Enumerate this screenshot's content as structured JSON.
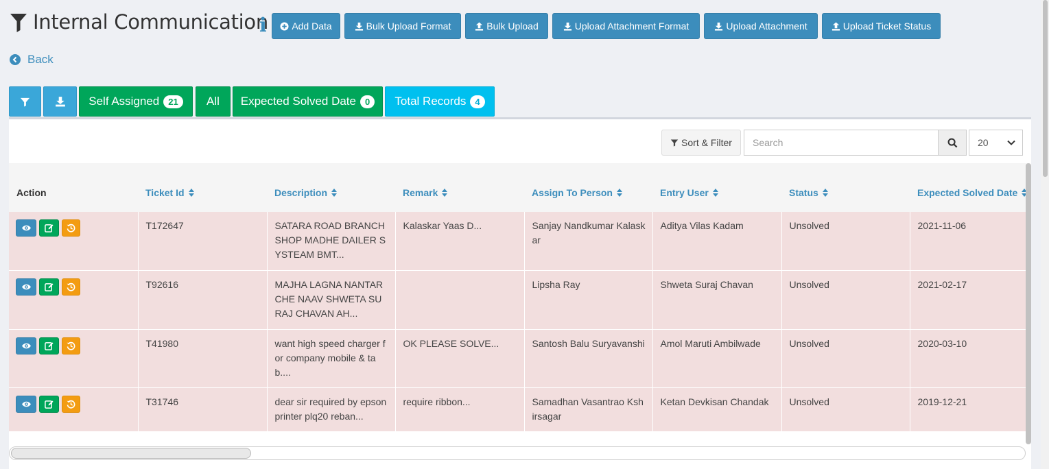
{
  "header": {
    "title": "Internal Communication",
    "info_glyph": "i",
    "buttons": [
      {
        "label": "Add Data",
        "icon": "plus-circle-icon"
      },
      {
        "label": "Bulk Upload Format",
        "icon": "download-icon"
      },
      {
        "label": "Bulk Upload",
        "icon": "upload-icon"
      },
      {
        "label": "Upload Attachment Format",
        "icon": "download-icon"
      },
      {
        "label": "Upload Attachment",
        "icon": "download-icon"
      },
      {
        "label": "Upload Ticket Status",
        "icon": "upload-icon"
      }
    ]
  },
  "back_label": "Back",
  "tabs": [
    {
      "label": "Self Assigned",
      "count": "21"
    },
    {
      "label": "All"
    },
    {
      "label": "Expected Solved Date",
      "count": "0"
    },
    {
      "label": "Total Records",
      "count": "4"
    }
  ],
  "toolbar": {
    "sort_filter_label": "Sort & Filter",
    "search_placeholder": "Search",
    "page_size": "20"
  },
  "table": {
    "columns": [
      "Action",
      "Ticket Id",
      "Description",
      "Remark",
      "Assign To Person",
      "Entry User",
      "Status",
      "Expected Solved Date"
    ],
    "rows": [
      {
        "ticket_id": "T172647",
        "description": "SATARA ROAD BRANCH SHOP MADHE DAILER SYSTEAM BMT...",
        "remark": "Kalaskar Yaas D...",
        "assign_to": "Sanjay Nandkumar Kalaskar",
        "entry_user": "Aditya Vilas Kadam",
        "status": "Unsolved",
        "expected_date": "2021-11-06"
      },
      {
        "ticket_id": "T92616",
        "description": "MAJHA LAGNA NANTAR CHE NAAV SHWETA SURAJ CHAVAN AH...",
        "remark": "",
        "assign_to": "Lipsha Ray",
        "entry_user": "Shweta Suraj Chavan",
        "status": "Unsolved",
        "expected_date": "2021-02-17"
      },
      {
        "ticket_id": "T41980",
        "description": "want high speed charger for company mobile & tab....",
        "remark": "OK PLEASE SOLVE...",
        "assign_to": "Santosh Balu Suryavanshi",
        "entry_user": "Amol Maruti Ambilwade",
        "status": "Unsolved",
        "expected_date": "2020-03-10"
      },
      {
        "ticket_id": "T31746",
        "description": "dear sir required by epson printer plq20 reban...",
        "remark": "require ribbon...",
        "assign_to": "Samadhan Vasantrao Kshirsagar",
        "entry_user": "Ketan Devkisan Chandak",
        "status": "Unsolved",
        "expected_date": "2019-12-21"
      }
    ]
  },
  "colors": {
    "primary": "#3c8dbc",
    "success": "#00a65a",
    "info": "#00c0ef",
    "warning": "#f39c12",
    "row_danger": "#f2dede"
  }
}
